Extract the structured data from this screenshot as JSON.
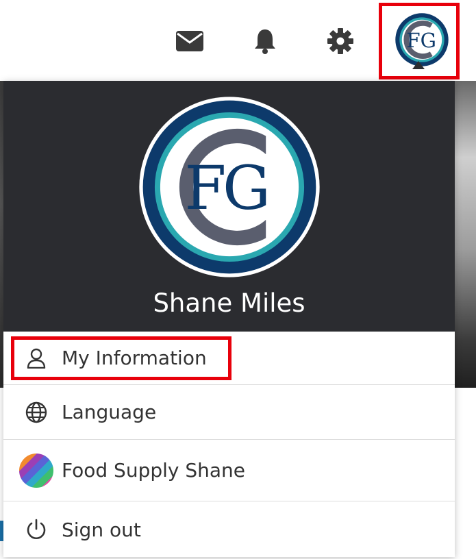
{
  "header": {
    "icons": [
      "mail-icon",
      "bell-icon",
      "gear-icon"
    ],
    "avatar_monogram": "FCG"
  },
  "profile": {
    "name": "Shane Miles",
    "logo_text": "FCG"
  },
  "menu": {
    "items": [
      {
        "label": "My Information",
        "icon": "person-icon",
        "highlighted": true
      },
      {
        "label": "Language",
        "icon": "globe-icon"
      },
      {
        "label": "Food Supply Shane",
        "icon": "organization-avatar"
      },
      {
        "label": "Sign out",
        "icon": "power-icon"
      }
    ]
  },
  "colors": {
    "panel_header": "#2b2c30",
    "highlight": "#e8000b",
    "logo_navy": "#0d3a6b",
    "logo_teal": "#2aa8b0",
    "logo_gray": "#5a5e6e"
  }
}
